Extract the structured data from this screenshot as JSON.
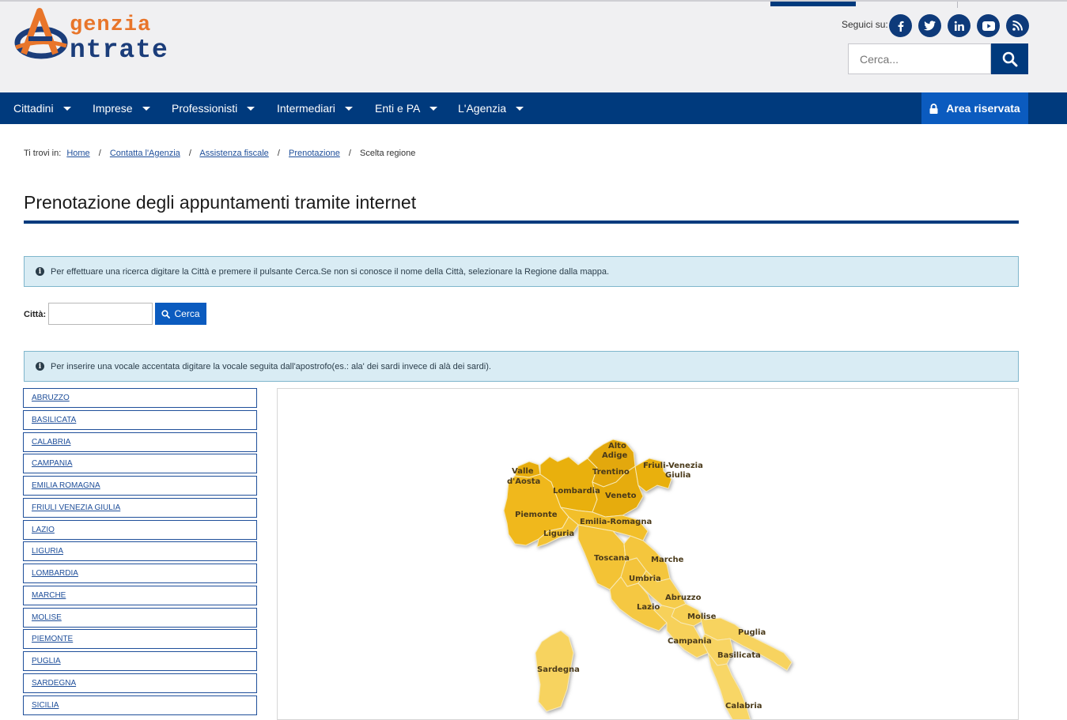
{
  "header": {
    "logo_line1": "genzia",
    "logo_line2": "ntrate",
    "social_label": "Seguici su:",
    "social_icons": [
      "facebook-icon",
      "twitter-icon",
      "linkedin-icon",
      "youtube-icon",
      "rss-icon"
    ],
    "search_placeholder": "Cerca..."
  },
  "nav": {
    "items": [
      "Cittadini",
      "Imprese",
      "Professionisti",
      "Intermediari",
      "Enti e PA",
      "L'Agenzia"
    ],
    "area_riservata": "Area riservata"
  },
  "breadcrumb": {
    "prefix": "Ti trovi in:",
    "links": [
      "Home",
      "Contatta l'Agenzia",
      "Assistenza fiscale",
      "Prenotazione"
    ],
    "current": "Scelta regione"
  },
  "page_title": "Prenotazione degli appuntamenti tramite internet",
  "info1": "Per effettuare una ricerca digitare la Città e premere il pulsante Cerca.Se non si conosce il nome della Città, selezionare la Regione dalla mappa.",
  "form": {
    "city_label": "Città:",
    "city_value": "",
    "search_button": "Cerca"
  },
  "info2": "Per inserire una vocale accentata digitare la vocale seguita dall'apostrofo(es.: ala' dei sardi invece di alà dei sardi).",
  "regions": [
    "ABRUZZO",
    "BASILICATA",
    "CALABRIA",
    "CAMPANIA",
    "EMILIA ROMAGNA",
    "FRIULI VENEZIA GIULIA",
    "LAZIO",
    "LIGURIA",
    "LOMBARDIA",
    "MARCHE",
    "MOLISE",
    "PIEMONTE",
    "PUGLIA",
    "SARDEGNA",
    "SICILIA"
  ],
  "map_labels": {
    "alto_adige_1": "Alto",
    "alto_adige_2": "Adige",
    "trentino": "Trentino",
    "friuli_1": "Friuli-Venezia",
    "friuli_2": "Giulia",
    "valle_1": "Valle",
    "valle_2": "d'Aosta",
    "lombardia": "Lombardia",
    "veneto": "Veneto",
    "piemonte": "Piemonte",
    "emilia": "Emilia-Romagna",
    "liguria": "Liguria",
    "toscana": "Toscana",
    "marche": "Marche",
    "umbria": "Umbria",
    "abruzzo": "Abruzzo",
    "lazio": "Lazio",
    "molise": "Molise",
    "campania": "Campania",
    "puglia": "Puglia",
    "basilicata": "Basilicata",
    "sardegna": "Sardegna",
    "calabria": "Calabria"
  },
  "colors": {
    "brand_blue": "#003a7d",
    "button_blue": "#0b5bbf",
    "logo_orange": "#e8752a",
    "map_north": "#e8b00e",
    "map_center": "#f2c02a",
    "map_south": "#f7cf58"
  }
}
